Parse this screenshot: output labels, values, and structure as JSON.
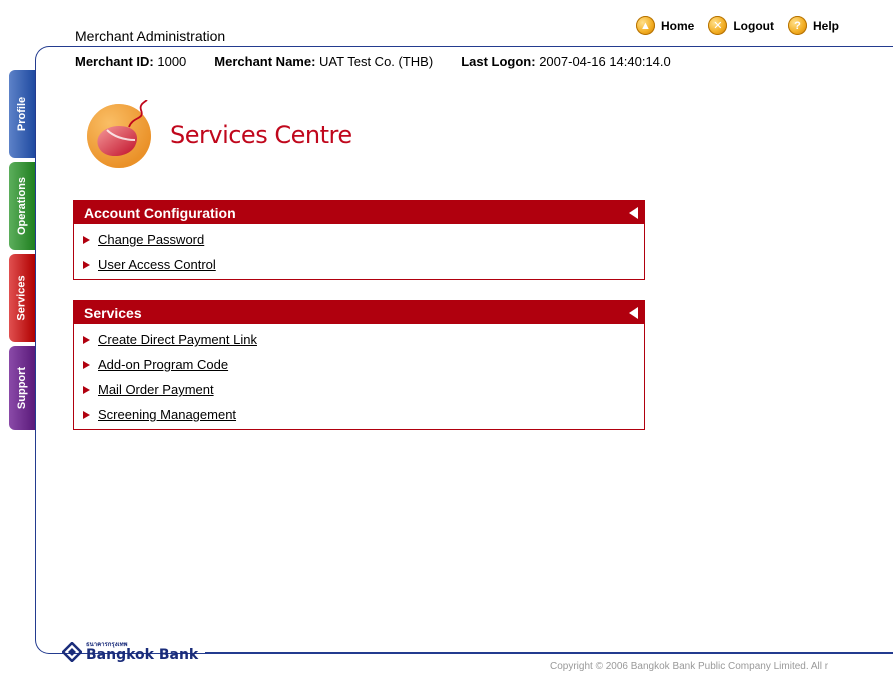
{
  "header": {
    "app_title": "Merchant Administration",
    "nav": [
      {
        "label": "Home",
        "icon": "home-icon",
        "glyph": "▲"
      },
      {
        "label": "Logout",
        "icon": "logout-icon",
        "glyph": "✕"
      },
      {
        "label": "Help",
        "icon": "help-icon",
        "glyph": "?"
      }
    ]
  },
  "merchant": {
    "id_label": "Merchant ID:",
    "id_value": "1000",
    "name_label": "Merchant Name:",
    "name_value": "UAT Test Co. (THB)",
    "logon_label": "Last Logon:",
    "logon_value": "2007-04-16 14:40:14.0"
  },
  "side_tabs": [
    {
      "label": "Profile"
    },
    {
      "label": "Operations"
    },
    {
      "label": "Services"
    },
    {
      "label": "Support"
    }
  ],
  "page_title": "Services Centre",
  "panels": [
    {
      "title": "Account Configuration",
      "items": [
        "Change Password",
        "User Access Control"
      ]
    },
    {
      "title": "Services",
      "items": [
        "Create Direct Payment Link",
        "Add-on Program Code",
        "Mail Order Payment",
        "Screening Management"
      ]
    }
  ],
  "footer": {
    "bank_thai": "ธนาคารกรุงเทพ",
    "bank_name": "Bangkok Bank",
    "copyright": "Copyright © 2006 Bangkok Bank Public Company Limited. All r"
  },
  "colors": {
    "accent_red": "#b0000e",
    "frame_blue": "#233b8f",
    "title_red": "#c0071c"
  }
}
